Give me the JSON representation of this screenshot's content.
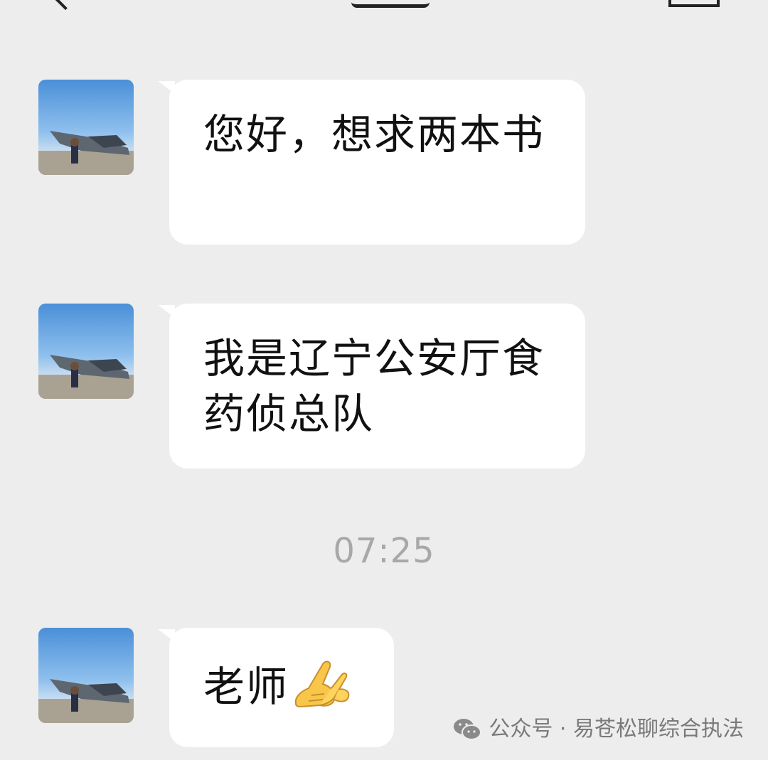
{
  "messages": [
    {
      "text": "您好，想求两本书"
    },
    {
      "text": "我是辽宁公安厅食药侦总队"
    },
    {
      "text": "老师",
      "emoji": "folded-hands-emoji"
    }
  ],
  "timestamp": "07:25",
  "watermark": {
    "text": "公众号 · 易苍松聊综合执法"
  },
  "icons": {
    "back": "chevron-left-icon",
    "more": "more-icon",
    "watermark": "wechat-icon"
  },
  "colors": {
    "background": "#EDEDED",
    "bubble": "#FFFFFF",
    "timestamp": "#A8A8A8",
    "text": "#111111"
  }
}
